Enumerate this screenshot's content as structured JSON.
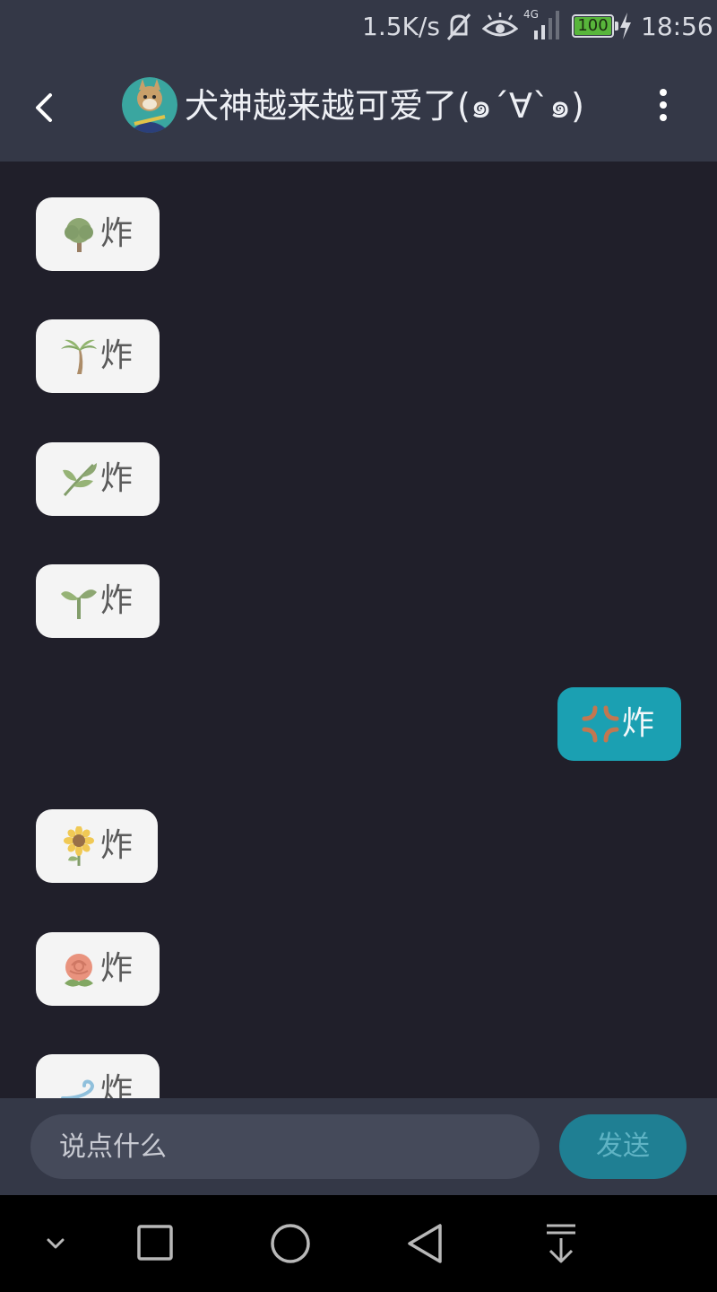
{
  "status_bar": {
    "network_speed": "1.5K/s",
    "network_type": "4G",
    "battery_level": "100",
    "time": "18:56"
  },
  "header": {
    "title": "犬神越来越可爱了(๑´∀`๑)"
  },
  "messages": [
    {
      "side": "in",
      "emoji": "deciduous-tree-icon",
      "text": "炸"
    },
    {
      "side": "in",
      "emoji": "palm-tree-icon",
      "text": "炸"
    },
    {
      "side": "in",
      "emoji": "herb-icon",
      "text": "炸"
    },
    {
      "side": "in",
      "emoji": "seedling-icon",
      "text": "炸"
    },
    {
      "side": "out",
      "emoji": "anger-symbol-icon",
      "text": "炸"
    },
    {
      "side": "in",
      "emoji": "sunflower-icon",
      "text": "炸"
    },
    {
      "side": "in",
      "emoji": "rose-icon",
      "text": "炸"
    },
    {
      "side": "in",
      "emoji": "dashing-away-icon",
      "text": "炸"
    }
  ],
  "input": {
    "placeholder": "说点什么",
    "send_label": "发送"
  },
  "colors": {
    "background": "#201f2a",
    "bar": "#343847",
    "incoming_bubble": "#f4f4f4",
    "outgoing_bubble": "#1ba0b2",
    "send_button": "#1f7f93"
  }
}
